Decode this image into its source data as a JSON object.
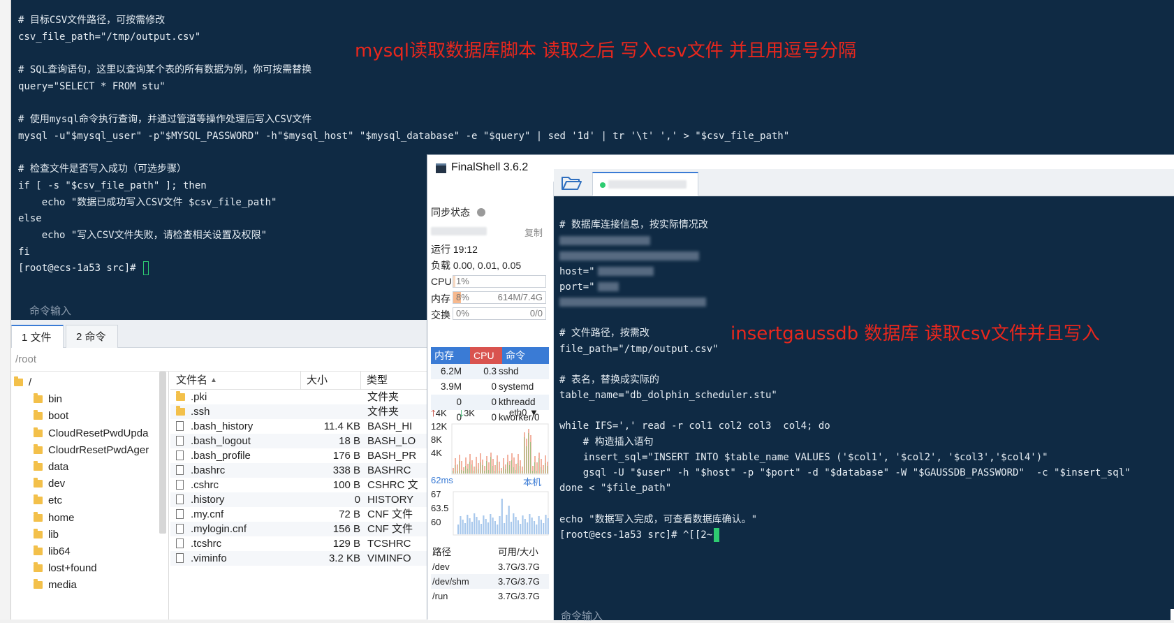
{
  "back_terminal": {
    "lines": [
      "# 目标CSV文件路径，可按需修改",
      "csv_file_path=\"/tmp/output.csv\"",
      "",
      "# SQL查询语句，这里以查询某个表的所有数据为例，你可按需替换",
      "query=\"SELECT * FROM stu\"",
      "",
      "# 使用mysql命令执行查询，并通过管道等操作处理后写入CSV文件",
      "mysql -u\"$mysql_user\" -p\"$MYSQL_PASSWORD\" -h\"$mysql_host\" \"$mysql_database\" -e \"$query\" | sed '1d' | tr '\\t' ',' > \"$csv_file_path\"",
      "",
      "# 检查文件是否写入成功（可选步骤）",
      "if [ -s \"$csv_file_path\" ]; then",
      "    echo \"数据已成功写入CSV文件 $csv_file_path\"",
      "else",
      "    echo \"写入CSV文件失败，请检查相关设置及权限\"",
      "fi"
    ],
    "prompt": "[root@ecs-1a53 src]# ",
    "annotation": "mysql读取数据库脚本 读取之后 写入csv文件 并且用逗号分隔",
    "command_input_label": "命令输入"
  },
  "file_panel": {
    "tabs": [
      {
        "label": "1 文件"
      },
      {
        "label": "2 命令"
      }
    ],
    "path": "/root",
    "tree": [
      {
        "label": "/",
        "type": "folder"
      },
      {
        "label": "bin",
        "type": "folder"
      },
      {
        "label": "boot",
        "type": "folder"
      },
      {
        "label": "CloudResetPwdUpda",
        "type": "folder"
      },
      {
        "label": "CloudrResetPwdAger",
        "type": "folder"
      },
      {
        "label": "data",
        "type": "folder"
      },
      {
        "label": "dev",
        "type": "folder"
      },
      {
        "label": "etc",
        "type": "folder"
      },
      {
        "label": "home",
        "type": "folder"
      },
      {
        "label": "lib",
        "type": "folder"
      },
      {
        "label": "lib64",
        "type": "folder"
      },
      {
        "label": "lost+found",
        "type": "folder"
      },
      {
        "label": "media",
        "type": "folder"
      }
    ],
    "columns": {
      "name": "文件名",
      "size": "大小",
      "type": "类型"
    },
    "files": [
      {
        "name": ".pki",
        "size": "",
        "type": "文件夹",
        "kind": "folder"
      },
      {
        "name": ".ssh",
        "size": "",
        "type": "文件夹",
        "kind": "folder"
      },
      {
        "name": ".bash_history",
        "size": "11.4 KB",
        "type": "BASH_HI",
        "kind": "file"
      },
      {
        "name": ".bash_logout",
        "size": "18 B",
        "type": "BASH_LO",
        "kind": "file"
      },
      {
        "name": ".bash_profile",
        "size": "176 B",
        "type": "BASH_PR",
        "kind": "file"
      },
      {
        "name": ".bashrc",
        "size": "338 B",
        "type": "BASHRC",
        "kind": "file"
      },
      {
        "name": ".cshrc",
        "size": "100 B",
        "type": "CSHRC 文",
        "kind": "file"
      },
      {
        "name": ".history",
        "size": "0",
        "type": "HISTORY",
        "kind": "file"
      },
      {
        "name": ".my.cnf",
        "size": "72 B",
        "type": "CNF 文件",
        "kind": "file"
      },
      {
        "name": ".mylogin.cnf",
        "size": "156 B",
        "type": "CNF 文件",
        "kind": "file"
      },
      {
        "name": ".tcshrc",
        "size": "129 B",
        "type": "TCSHRC",
        "kind": "file"
      },
      {
        "name": ".viminfo",
        "size": "3.2 KB",
        "type": "VIMINFO",
        "kind": "file"
      }
    ]
  },
  "finalshell": {
    "title": "FinalShell 3.6.2",
    "sidebar": {
      "sync_label": "同步状态",
      "copy_label": "复制",
      "uptime": "运行 19:12",
      "load": "负载 0.00, 0.01, 0.05",
      "cpu_label": "CPU",
      "cpu_pct": "1%",
      "cpu_value": 0.01,
      "mem_label": "内存",
      "mem_pct": "8%",
      "mem_value": 0.08,
      "mem_total": "614M/7.4G",
      "swap_label": "交换",
      "swap_pct": "0%",
      "swap_value": 0,
      "swap_total": "0/0",
      "proc_headers": {
        "mem": "内存",
        "cpu": "CPU",
        "cmd": "命令"
      },
      "processes": [
        {
          "mem": "6.2M",
          "cpu": "0.3",
          "cmd": "sshd"
        },
        {
          "mem": "3.9M",
          "cpu": "0",
          "cmd": "systemd"
        },
        {
          "mem": "0",
          "cpu": "0",
          "cmd": "kthreadd"
        },
        {
          "mem": "0",
          "cpu": "0",
          "cmd": "kworker/0"
        }
      ],
      "net": {
        "up": "4K",
        "down": "3K",
        "iface": "eth0",
        "ticks": [
          "12K",
          "8K",
          "4K"
        ]
      },
      "ping": {
        "latency": "62ms",
        "host": "本机",
        "ticks": [
          "67",
          "63.5",
          "60"
        ]
      },
      "disk_headers": {
        "path": "路径",
        "avail": "可用/大小"
      },
      "disks": [
        {
          "path": "/dev",
          "avail": "3.7G/3.7G"
        },
        {
          "path": "/dev/shm",
          "avail": "3.7G/3.7G"
        },
        {
          "path": "/run",
          "avail": "3.7G/3.7G"
        }
      ]
    },
    "terminal": {
      "lines": [
        "# 数据库连接信息，按实际情况改",
        "",
        "",
        "host=\"",
        "port=\"",
        "",
        "",
        "# 文件路径，按需改",
        "file_path=\"/tmp/output.csv\"",
        "",
        "# 表名，替换成实际的",
        "table_name=\"db_dolphin_scheduler.stu\"",
        "",
        "while IFS=',' read -r col1 col2 col3  col4; do",
        "    # 构造插入语句",
        "    insert_sql=\"INSERT INTO $table_name VALUES ('$col1', '$col2', '$col3','$col4')\"",
        "    gsql -U \"$user\" -h \"$host\" -p \"$port\" -d \"$database\" -W \"$GAUSSDB_PASSWORD\"  -c \"$insert_sql\"",
        "done < \"$file_path\"",
        "",
        "echo \"数据写入完成，可查看数据库确认。\""
      ],
      "prompt": "[root@ecs-1a53 src]# ^[[2~",
      "annotation": "insertgaussdb 数据库 读取csv文件并且写入",
      "command_input_label": "命令输入"
    }
  }
}
